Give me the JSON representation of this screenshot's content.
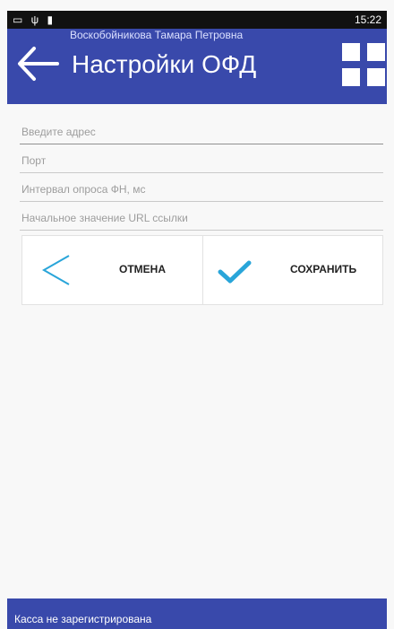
{
  "statusbar": {
    "left_icons": "▭ ψ ▮",
    "right_text": "15:22"
  },
  "header": {
    "user_name": "Воскобойникова Тамара Петровна",
    "title": "Настройки ОФД",
    "back_icon": "arrow-left-icon",
    "menu_icon": "grid-icon"
  },
  "form": {
    "address_placeholder": "Введите адрес",
    "port_placeholder": "Порт",
    "interval_placeholder": "Интервал опроса ФН, мс",
    "url_placeholder": "Начальное значение URL ссылки"
  },
  "actions": {
    "cancel_label": "ОТМЕНА",
    "save_label": "СОХРАНИТЬ"
  },
  "footer": {
    "status_text": "Касса не зарегистрирована"
  },
  "colors": {
    "primary": "#3949ab",
    "icon_accent": "#29a5d9"
  }
}
